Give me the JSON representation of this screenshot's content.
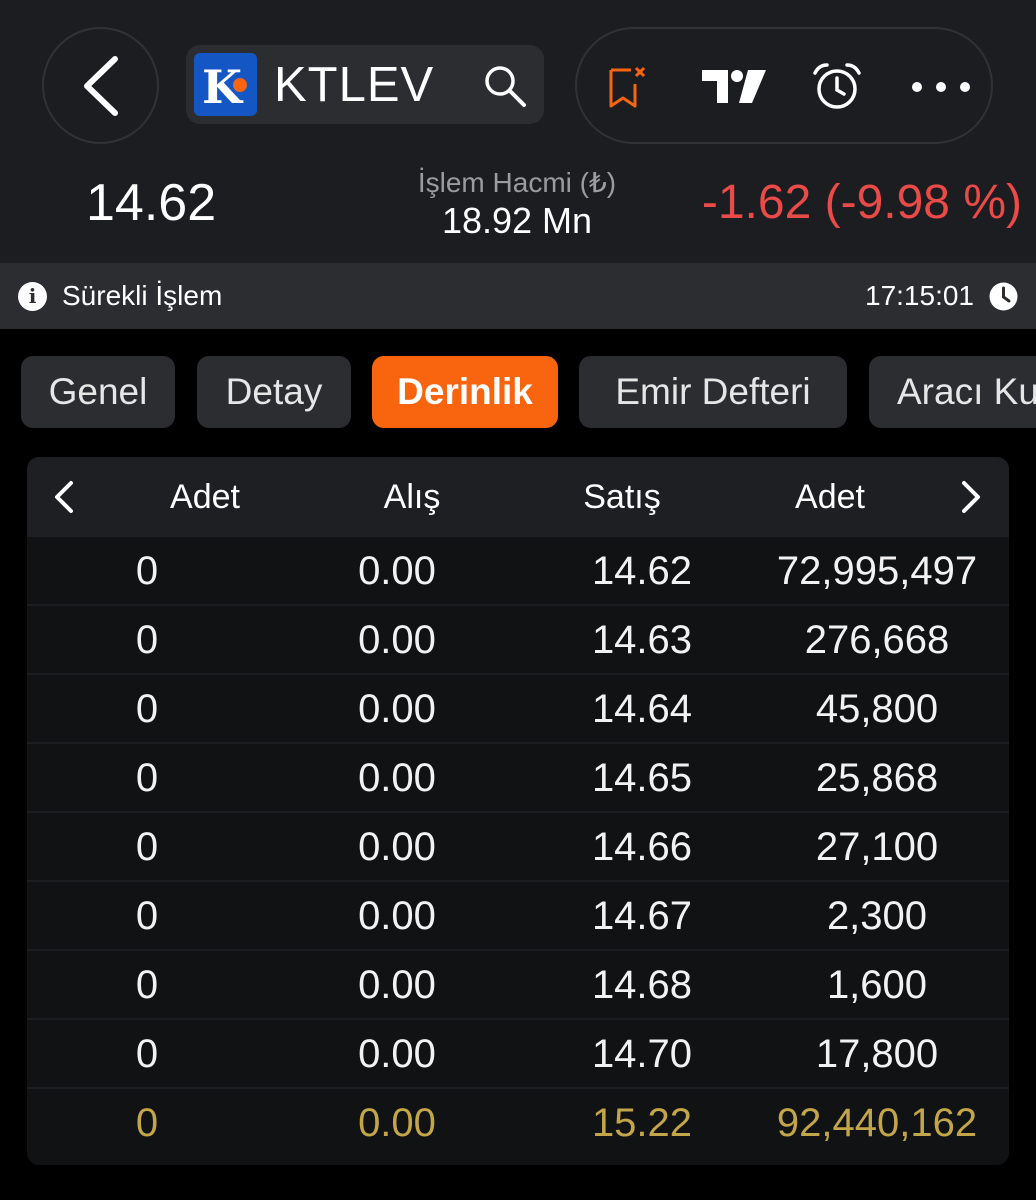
{
  "header": {
    "symbol": "KTLEV",
    "price": "14.62",
    "volume_label": "İşlem Hacmi (₺)",
    "volume_value": "18.92 Mn",
    "change": "-1.62 (-9.98 %)"
  },
  "status": {
    "label": "Sürekli İşlem",
    "time": "17:15:01"
  },
  "tabs": [
    {
      "label": "Genel",
      "active": false
    },
    {
      "label": "Detay",
      "active": false
    },
    {
      "label": "Derinlik",
      "active": true
    },
    {
      "label": "Emir Defteri",
      "active": false
    },
    {
      "label": "Aracı Kurum",
      "active": false
    }
  ],
  "depth": {
    "columns": [
      "Adet",
      "Alış",
      "Satış",
      "Adet"
    ],
    "rows": [
      {
        "bid_qty": "0",
        "bid": "0.00",
        "ask": "14.62",
        "ask_qty": "72,995,497"
      },
      {
        "bid_qty": "0",
        "bid": "0.00",
        "ask": "14.63",
        "ask_qty": "276,668"
      },
      {
        "bid_qty": "0",
        "bid": "0.00",
        "ask": "14.64",
        "ask_qty": "45,800"
      },
      {
        "bid_qty": "0",
        "bid": "0.00",
        "ask": "14.65",
        "ask_qty": "25,868"
      },
      {
        "bid_qty": "0",
        "bid": "0.00",
        "ask": "14.66",
        "ask_qty": "27,100"
      },
      {
        "bid_qty": "0",
        "bid": "0.00",
        "ask": "14.67",
        "ask_qty": "2,300"
      },
      {
        "bid_qty": "0",
        "bid": "0.00",
        "ask": "14.68",
        "ask_qty": "1,600"
      },
      {
        "bid_qty": "0",
        "bid": "0.00",
        "ask": "14.70",
        "ask_qty": "17,800"
      }
    ],
    "total": {
      "bid_qty": "0",
      "bid": "0.00",
      "ask": "15.22",
      "ask_qty": "92,440,162"
    }
  },
  "colors": {
    "accent": "#f9650f",
    "negative": "#ea4a48",
    "total": "#c3a64a"
  },
  "icons": [
    "back-arrow-icon",
    "search-icon",
    "bookmark-remove-icon",
    "tradingview-icon",
    "alarm-icon",
    "more-icon",
    "info-icon",
    "clock-icon",
    "chevron-left-icon",
    "chevron-right-icon"
  ]
}
